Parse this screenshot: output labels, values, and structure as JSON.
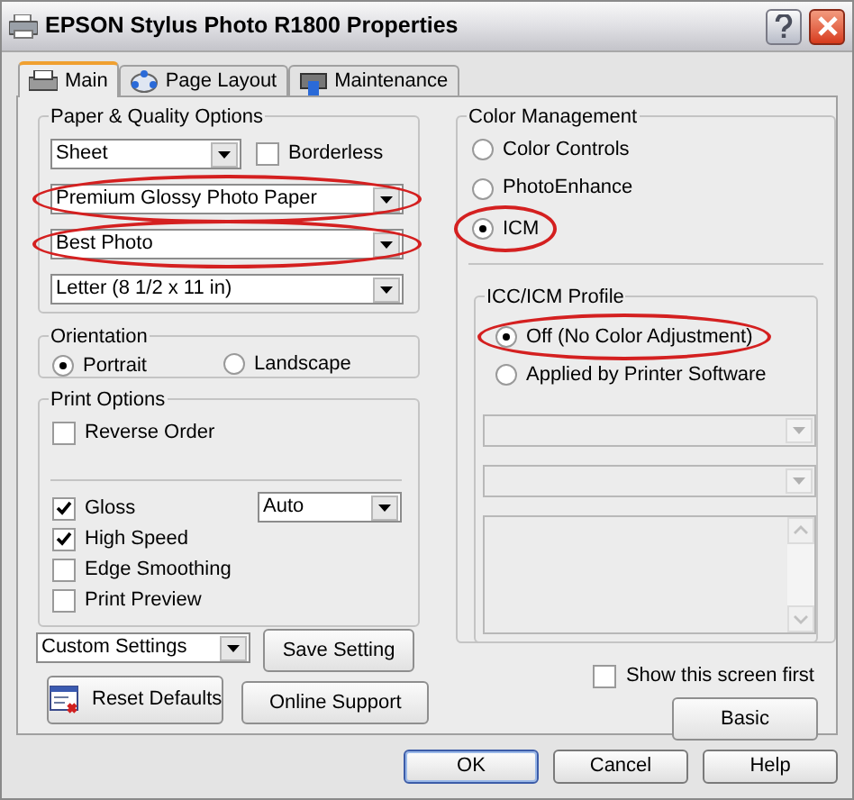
{
  "window": {
    "title": "EPSON Stylus Photo R1800 Properties"
  },
  "tabs": [
    {
      "label": "Main",
      "selected": true
    },
    {
      "label": "Page Layout",
      "selected": false
    },
    {
      "label": "Maintenance",
      "selected": false
    }
  ],
  "paper_quality": {
    "title": "Paper & Quality Options",
    "source": {
      "value": "Sheet"
    },
    "borderless": {
      "label": "Borderless",
      "checked": false
    },
    "media_type": {
      "value": "Premium Glossy Photo Paper",
      "highlighted": true
    },
    "quality": {
      "value": "Best Photo",
      "highlighted": true
    },
    "paper_size": {
      "value": "Letter (8 1/2 x 11 in)",
      "highlighted": false
    }
  },
  "orientation": {
    "title": "Orientation",
    "options": [
      {
        "label": "Portrait",
        "selected": true
      },
      {
        "label": "Landscape",
        "selected": false
      }
    ]
  },
  "print_options": {
    "title": "Print Options",
    "reverse_order": {
      "label": "Reverse Order",
      "checked": false
    },
    "gloss_mode": {
      "value": "Auto"
    },
    "checkboxes": [
      {
        "label": "Gloss",
        "checked": true
      },
      {
        "label": "High Speed",
        "checked": true
      },
      {
        "label": "Edge Smoothing",
        "checked": false
      },
      {
        "label": "Print Preview",
        "checked": false
      }
    ]
  },
  "custom_settings": {
    "value": "Custom Settings"
  },
  "save_button": "Save Setting",
  "reset_button": "Reset Defaults",
  "online_button": "Online Support",
  "color_management": {
    "title": "Color Management",
    "options": [
      {
        "label": "Color Controls",
        "selected": false,
        "highlighted": false
      },
      {
        "label": "PhotoEnhance",
        "selected": false,
        "highlighted": false
      },
      {
        "label": "ICM",
        "selected": true,
        "highlighted": true
      }
    ]
  },
  "icc_profile": {
    "title": "ICC/ICM Profile",
    "options": [
      {
        "label": "Off (No Color Adjustment)",
        "selected": true,
        "highlighted": true
      },
      {
        "label": "Applied by Printer Software",
        "selected": false,
        "highlighted": false
      }
    ],
    "fields": [
      {
        "kind": "dropdown",
        "disabled": true
      },
      {
        "kind": "dropdown",
        "disabled": true
      },
      {
        "kind": "list",
        "disabled": true
      }
    ]
  },
  "show_first": {
    "label": "Show this screen first",
    "checked": false
  },
  "basic_button": "Basic",
  "dialog_buttons": [
    {
      "label": "OK",
      "default": true
    },
    {
      "label": "Cancel",
      "default": false
    },
    {
      "label": "Help",
      "default": false
    }
  ]
}
